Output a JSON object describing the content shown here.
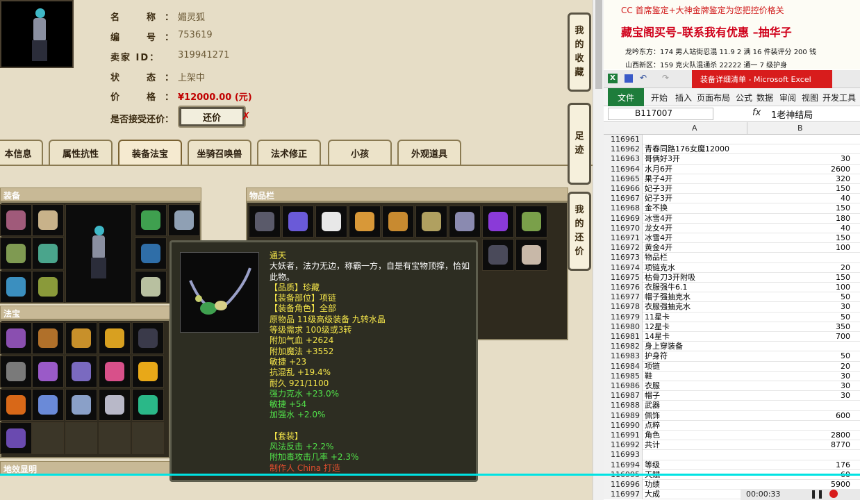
{
  "info": {
    "name_label": "名　称：",
    "name_value": "媚灵狐",
    "id_label": "编　号：",
    "id_value": "753619",
    "seller_label": "卖家 ID：",
    "seller_value": "319941271",
    "status_label": "状　态：",
    "status_value": "上架中",
    "price_label": "价　格：",
    "price_value": "¥12000.00 (元)",
    "bargain_label": "是否接受还价：",
    "bargain_button": "还价",
    "bargain_mark": "✗"
  },
  "tabs": [
    "本信息",
    "属性抗性",
    "装备法宝",
    "坐骑召唤兽",
    "法术修正",
    "小孩",
    "外观道具"
  ],
  "panels": {
    "equip": "装备",
    "fabao": "法宝",
    "inventory": "物品栏",
    "footprint_bottom": "地效显明"
  },
  "side_buttons": {
    "collect": [
      "我",
      "的",
      "收",
      "藏"
    ],
    "footprint": [
      "足",
      "迹"
    ],
    "bargain": [
      "我",
      "的",
      "还",
      "价"
    ]
  },
  "tooltip": {
    "name": "通天",
    "desc": "大妖者，法力无边，称霸一方，自是有宝物顶撑，恰如此物。",
    "quality": "【品质】珍藏",
    "part": "【装备部位】项链",
    "role": "【装备角色】全部",
    "origin": "原物品 11级高级装备 九转水晶",
    "req": "等级需求 100级或3转",
    "attrs": [
      "附加气血 +2624",
      "附加魔法 +3552",
      "敏捷 +23",
      "抗混乱 +19.4%",
      "耐久 921/1100"
    ],
    "green": [
      "强力克水 +23.0%",
      "敏捷 +54",
      "加强水 +2.0%"
    ],
    "set_title": "【套装】",
    "set": [
      "风法反击 +2.2%",
      "附加毒攻击几率 +2.3%"
    ],
    "maker": "制作人 China 打造"
  },
  "promo": {
    "line1": "CC 首席鉴定+大神金牌鉴定为您把控价格关",
    "line2": "藏宝阁买号–联系我有优惠 –抽华子",
    "line3": "龙吟东方：174 男人站街忍混 11.9 2 满 16 件装评分 200 钱",
    "line4": "山西新区：159 克火队混通杀 22222 通一 7 级护身"
  },
  "excel": {
    "title": "装备详细清单 - Microsoft Excel",
    "menu": [
      "文件",
      "开始",
      "插入",
      "页面布局",
      "公式",
      "数据",
      "审阅",
      "视图",
      "开发工具"
    ],
    "namebox": "B117007",
    "fx": "fx",
    "formula": "1老神结局",
    "col_a": "A",
    "col_b": "B",
    "rows": [
      {
        "n": "116961",
        "a": "",
        "b": ""
      },
      {
        "n": "116962",
        "a": "青春同路176女魔12000",
        "b": ""
      },
      {
        "n": "116963",
        "a": "哥俩好3开",
        "b": "30"
      },
      {
        "n": "116964",
        "a": "水月6开",
        "b": "2600"
      },
      {
        "n": "116965",
        "a": "果子4开",
        "b": "320"
      },
      {
        "n": "116966",
        "a": "妃子3开",
        "b": "150"
      },
      {
        "n": "116967",
        "a": "妃子3开",
        "b": "40"
      },
      {
        "n": "116968",
        "a": "金不换",
        "b": "150"
      },
      {
        "n": "116969",
        "a": "冰雪4开",
        "b": "180"
      },
      {
        "n": "116970",
        "a": "龙女4开",
        "b": "40"
      },
      {
        "n": "116971",
        "a": "冰雪4开",
        "b": "150"
      },
      {
        "n": "116972",
        "a": "黄金4开",
        "b": "100"
      },
      {
        "n": "116973",
        "a": "物品栏",
        "b": ""
      },
      {
        "n": "116974",
        "a": "项链克水",
        "b": "20"
      },
      {
        "n": "116975",
        "a": "枯骨刀3开附吸",
        "b": "150"
      },
      {
        "n": "116976",
        "a": "衣服强牛6.1",
        "b": "100"
      },
      {
        "n": "116977",
        "a": "帽子强抽克水",
        "b": "50"
      },
      {
        "n": "116978",
        "a": "衣服强抽克水",
        "b": "30"
      },
      {
        "n": "116979",
        "a": "11星卡",
        "b": "50"
      },
      {
        "n": "116980",
        "a": "12星卡",
        "b": "350"
      },
      {
        "n": "116981",
        "a": "14星卡",
        "b": "700"
      },
      {
        "n": "116982",
        "a": "身上穿装备",
        "b": ""
      },
      {
        "n": "116983",
        "a": "护身符",
        "b": "50"
      },
      {
        "n": "116984",
        "a": "项链",
        "b": "20"
      },
      {
        "n": "116985",
        "a": "鞋",
        "b": "30"
      },
      {
        "n": "116986",
        "a": "衣服",
        "b": "30"
      },
      {
        "n": "116987",
        "a": "帽子",
        "b": "30"
      },
      {
        "n": "116988",
        "a": "武器",
        "b": ""
      },
      {
        "n": "116989",
        "a": "佩饰",
        "b": "600"
      },
      {
        "n": "116990",
        "a": "点粹",
        "b": ""
      },
      {
        "n": "116991",
        "a": "角色",
        "b": "2800"
      },
      {
        "n": "116992",
        "a": "共计",
        "b": "8770"
      },
      {
        "n": "116993",
        "a": "",
        "b": ""
      },
      {
        "n": "116994",
        "a": "等级",
        "b": "176"
      },
      {
        "n": "116995",
        "a": "天赋",
        "b": "60"
      },
      {
        "n": "116996",
        "a": "功绩",
        "b": "5900"
      },
      {
        "n": "116997",
        "a": "大成",
        "b": ""
      }
    ]
  },
  "player": {
    "time": "00:00:33"
  },
  "colors": {
    "price": "#c00000",
    "tooltip_yellow": "#f5e64a",
    "tooltip_green": "#52e34a",
    "excel_green": "#1e7d3b",
    "excel_red": "#d81c1c",
    "cyan": "#00e3e3"
  }
}
